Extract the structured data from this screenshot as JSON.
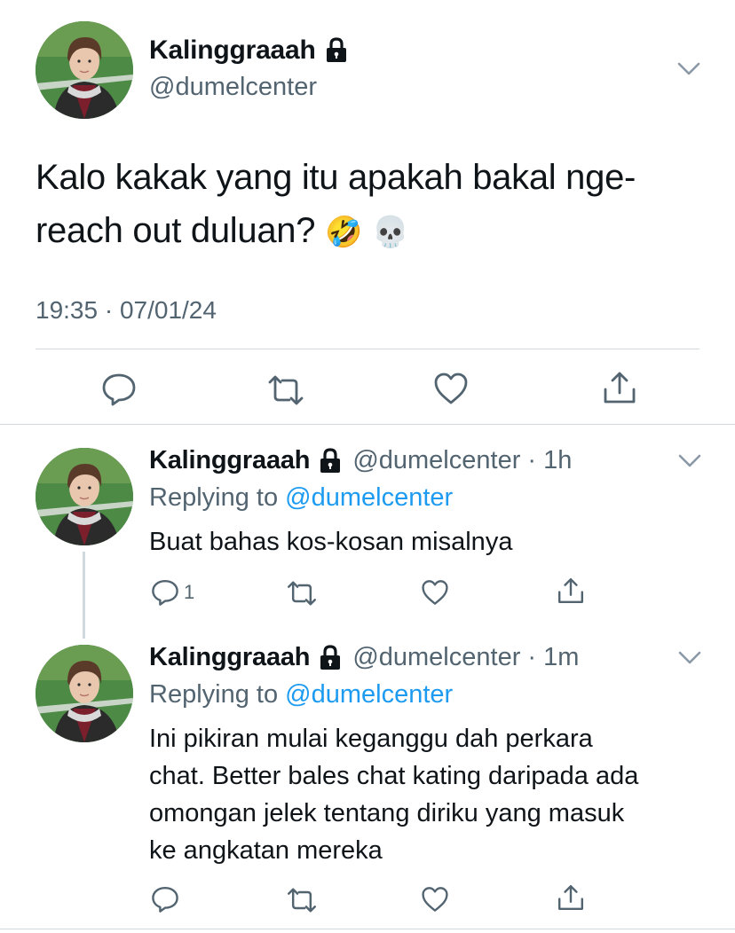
{
  "main_tweet": {
    "display_name": "Kalinggraaah",
    "handle": "@dumelcenter",
    "text": "Kalo kakak yang itu apakah bakal nge-reach out duluan?",
    "emojis": "🤣 💀",
    "timestamp": "19:35 · 07/01/24"
  },
  "replies": [
    {
      "display_name": "Kalinggraaah",
      "handle": "@dumelcenter",
      "time": "1h",
      "replying_prefix": "Replying to",
      "replying_to": "@dumelcenter",
      "text": "Buat bahas kos-kosan misalnya",
      "reply_count": "1"
    },
    {
      "display_name": "Kalinggraaah",
      "handle": "@dumelcenter",
      "time": "1m",
      "replying_prefix": "Replying to",
      "replying_to": "@dumelcenter",
      "text_lines": [
        "Ini pikiran mulai keganggu dah perkara",
        "chat. Better bales chat kating daripada ada",
        "omongan jelek tentang diriku yang masuk",
        "ke angkatan mereka"
      ]
    }
  ],
  "colors": {
    "text": "#0f1419",
    "secondary": "#536471",
    "link": "#1d9bf0",
    "divider": "#cfd9de"
  },
  "icons": [
    "lock-icon",
    "chevron-down-icon",
    "reply-icon",
    "retweet-icon",
    "like-icon",
    "share-icon"
  ]
}
